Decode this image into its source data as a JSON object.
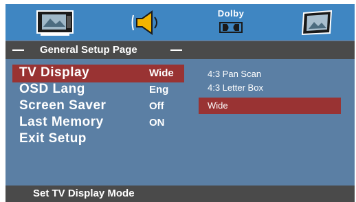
{
  "tabs": [
    {
      "icon": "tv-icon"
    },
    {
      "icon": "speaker-icon"
    },
    {
      "label": "Dolby",
      "icon": "dolby-icon"
    },
    {
      "icon": "picture-icon"
    }
  ],
  "page_title": "General Setup Page",
  "menu": {
    "items": [
      {
        "label": "TV Display",
        "value": "Wide",
        "selected": true
      },
      {
        "label": "OSD Lang",
        "value": "Eng"
      },
      {
        "label": "Screen Saver",
        "value": "Off"
      },
      {
        "label": "Last Memory",
        "value": "ON"
      },
      {
        "label": "Exit Setup",
        "value": ""
      }
    ]
  },
  "options": [
    {
      "label": "4:3 Pan Scan"
    },
    {
      "label": "4:3 Letter Box"
    },
    {
      "label": "Wide",
      "selected": true
    }
  ],
  "footer": {
    "hint": "Set TV Display Mode"
  },
  "colors": {
    "background": "#5b7fa4",
    "tab_bar": "#3f86c2",
    "title_bar": "#4a4a4a",
    "highlight": "#993333",
    "text": "#ffffff"
  }
}
